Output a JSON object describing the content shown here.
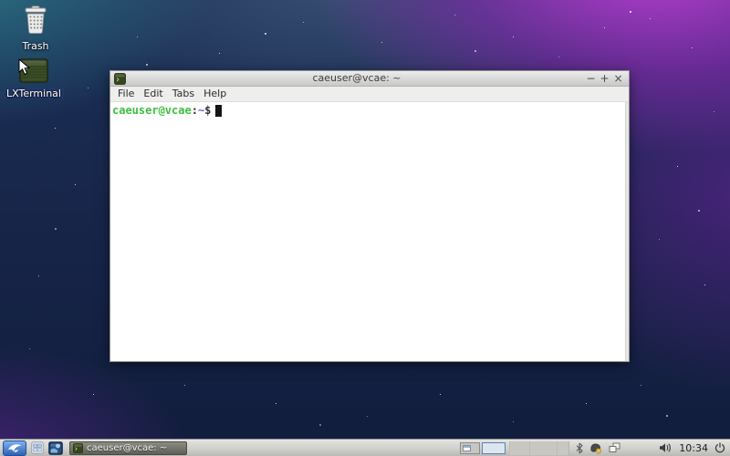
{
  "desktop": {
    "icons": [
      {
        "name": "trash",
        "label": "Trash"
      },
      {
        "name": "lxterminal",
        "label": "LXTerminal"
      }
    ]
  },
  "window": {
    "title": "caeuser@vcae: ~",
    "controls": {
      "minimize": "−",
      "maximize": "+",
      "close": "×"
    },
    "menu": [
      {
        "label": "File"
      },
      {
        "label": "Edit"
      },
      {
        "label": "Tabs"
      },
      {
        "label": "Help"
      }
    ],
    "terminal": {
      "user": "caeuser@vcae",
      "colon": ":",
      "path": "~",
      "dollar": "$"
    }
  },
  "taskbar": {
    "task_button_label": "caeuser@vcae: ~",
    "clock": "10:34"
  },
  "colors": {
    "prompt_green": "#3fbf3f",
    "prompt_blue": "#6565cd",
    "wallpaper_purple": "#a22cc4",
    "wallpaper_teal": "#2e7a8a",
    "wallpaper_navy": "#16254a",
    "panel_bg": "#cfcfcb",
    "titlebar_bg": "#d9d9d9"
  }
}
